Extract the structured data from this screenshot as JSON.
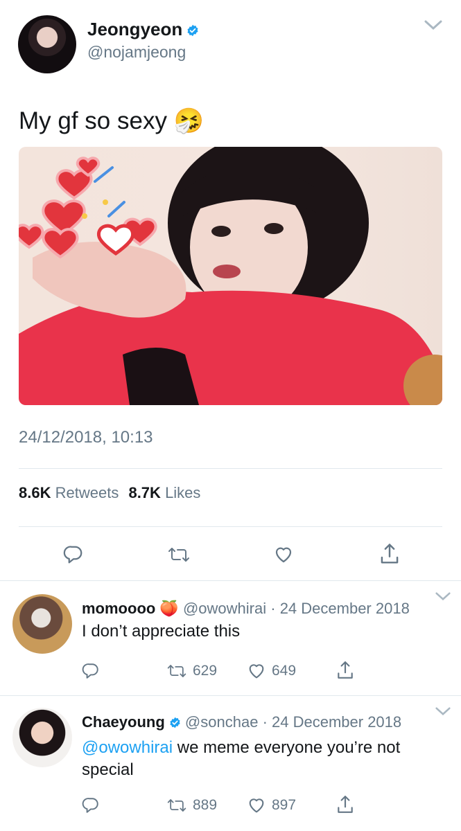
{
  "tweet": {
    "display_name": "Jeongyeon",
    "handle": "@nojamjeong",
    "text": "My gf so sexy 🤧",
    "timestamp": "24/12/2018, 10:13",
    "retweets_count": "8.6K",
    "retweets_label": "Retweets",
    "likes_count": "8.7K",
    "likes_label": "Likes"
  },
  "replies": [
    {
      "display_name": "momoooo 🍑",
      "handle": "@owowhirai",
      "date": "24 December 2018",
      "text": "I don’t appreciate this",
      "retweets": "629",
      "likes": "649"
    },
    {
      "display_name": "Chaeyoung",
      "handle": "@sonchae",
      "date": "24 December 2018",
      "mention": "@owowhirai",
      "text_line1": " we meme everyone you’re not",
      "text_line2": "special",
      "retweets": "889",
      "likes": "897"
    }
  ],
  "icons": {
    "verified": "verified-badge-icon",
    "more": "chevron-down-icon",
    "reply": "reply-icon",
    "retweet": "retweet-icon",
    "like": "heart-icon",
    "share": "share-icon"
  },
  "colors": {
    "brand": "#1da1f2",
    "text": "#14171a",
    "secondary": "#657786"
  }
}
